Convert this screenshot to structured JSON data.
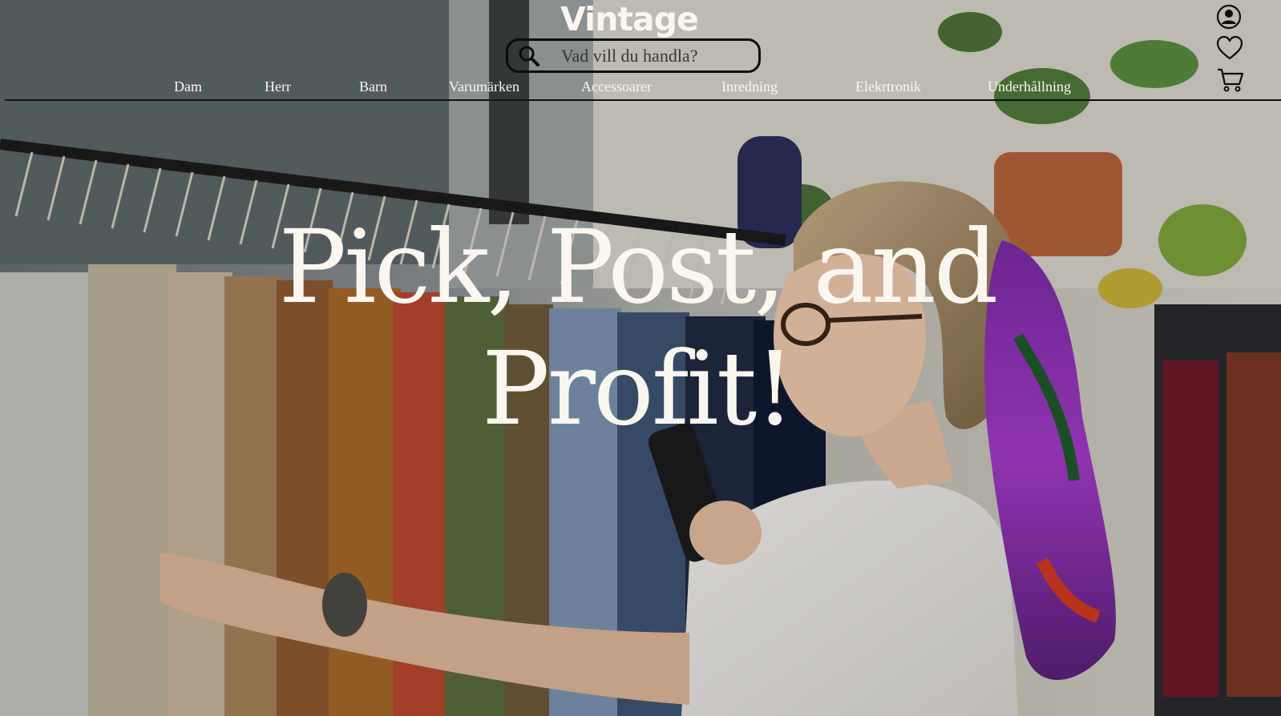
{
  "brand": {
    "name": "Vintage"
  },
  "search": {
    "placeholder": "Vad vill du handla?",
    "icon": "search-icon"
  },
  "nav": {
    "items": [
      {
        "label": "Dam"
      },
      {
        "label": "Herr"
      },
      {
        "label": "Barn"
      },
      {
        "label": "Varumärken"
      },
      {
        "label": "Accessoarer"
      },
      {
        "label": "Inredning"
      },
      {
        "label": "Elekrtronik"
      },
      {
        "label": "Underhållning"
      }
    ]
  },
  "header_icons": [
    "account-icon",
    "heart-icon",
    "cart-icon"
  ],
  "hero": {
    "line1": "Pick, Post, and",
    "line2": "Profit!"
  },
  "colors": {
    "text_light": "#fbf7f0",
    "outline_dark": "#0c0c0c"
  }
}
